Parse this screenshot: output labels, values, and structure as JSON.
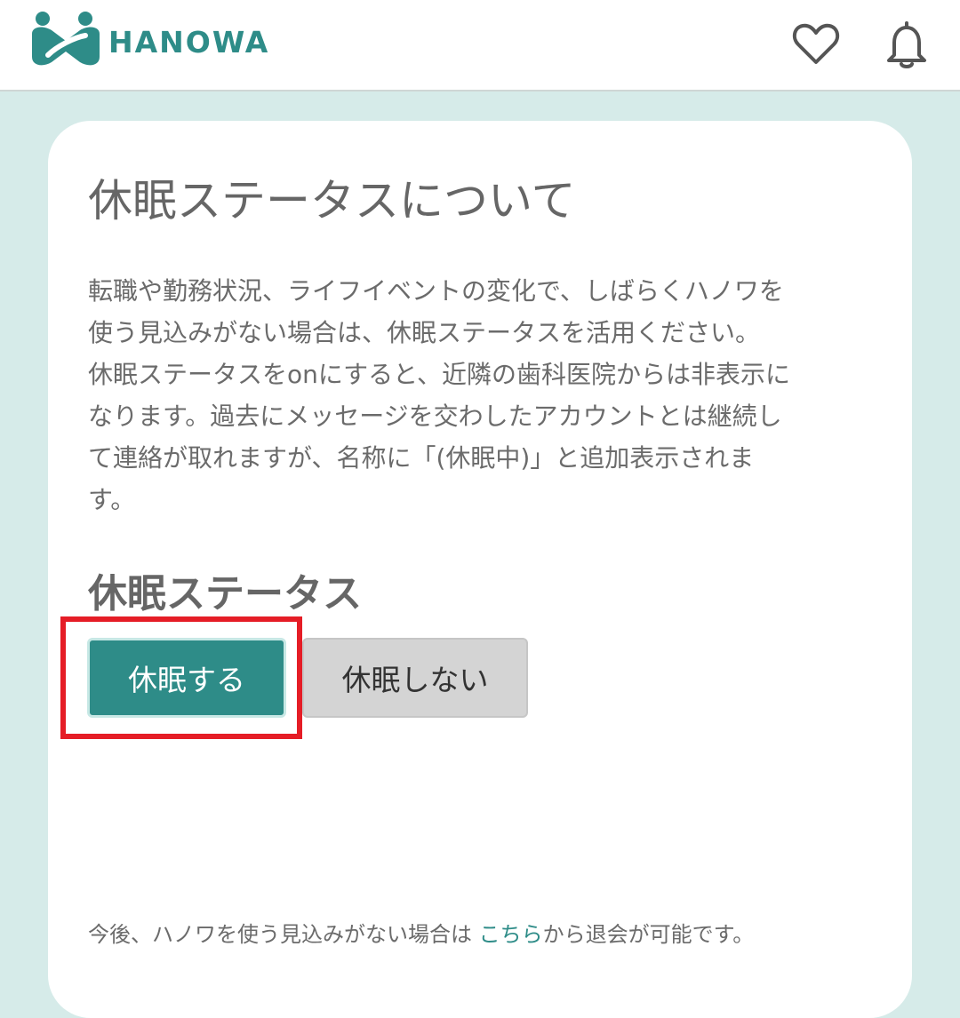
{
  "header": {
    "brand": "HANOWA",
    "logo_icon": "hanowa-logo-icon",
    "favorite_icon": "heart-icon",
    "notification_icon": "bell-icon",
    "brand_color": "#2e8c88"
  },
  "main": {
    "title": "休眠ステータスについて",
    "description_lines": [
      "転職や勤務状況、ライフイベントの変化で、しばらくハノワを",
      "使う見込みがない場合は、休眠ステータスを活用ください。",
      "休眠ステータスをonにすると、近隣の歯科医院からは非表示に",
      "なります。過去にメッセージを交わしたアカウントとは継続し",
      "て連絡が取れますが、名称に「(休眠中)」と追加表示されま",
      "す。"
    ],
    "status_heading": "休眠ステータス",
    "buttons": {
      "sleep": "休眠する",
      "no_sleep": "休眠しない"
    },
    "footer": {
      "before_link": "今後、ハノワを使う見込みがない場合は ",
      "link": "こちら",
      "after_link": "から退会が可能です。"
    }
  },
  "colors": {
    "background": "#d6ebe9",
    "accent": "#2e8c88",
    "highlight_box": "#e51d26"
  }
}
